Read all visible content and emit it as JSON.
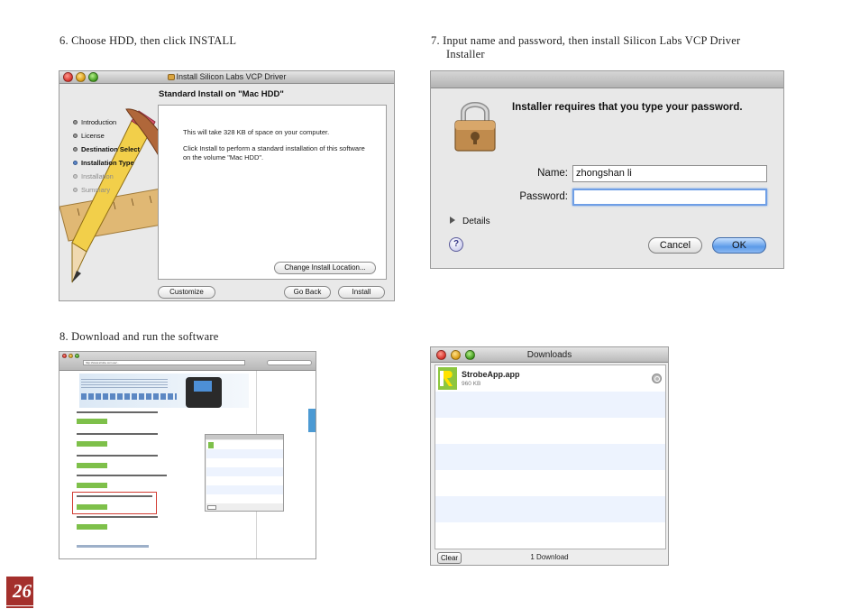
{
  "captions": {
    "step6": "6. Choose HDD, then click INSTALL",
    "step7_line1": "7. Input name and password, then install Silicon Labs VCP Driver",
    "step7_line2": "Installer",
    "step8": "8. Download and run the software"
  },
  "installer": {
    "title": "Install Silicon Labs VCP Driver",
    "heading": "Standard Install on \"Mac HDD\"",
    "steps": [
      {
        "label": "Introduction",
        "state": "done"
      },
      {
        "label": "License",
        "state": "done"
      },
      {
        "label": "Destination Select",
        "state": "done"
      },
      {
        "label": "Installation Type",
        "state": "active"
      },
      {
        "label": "Installation",
        "state": "pending"
      },
      {
        "label": "Summary",
        "state": "pending"
      }
    ],
    "space_text": "This will take 328 KB of space on your computer.",
    "install_text": "Click Install to perform a standard installation of this software on the volume \"Mac HDD\".",
    "change_location_label": "Change Install Location...",
    "customize_label": "Customize",
    "go_back_label": "Go Back",
    "install_label": "Install"
  },
  "auth": {
    "message": "Installer requires that you type your password.",
    "name_label": "Name:",
    "name_value": "zhongshan li",
    "password_label": "Password:",
    "password_value": "",
    "details_label": "Details",
    "help_label": "?",
    "cancel_label": "Cancel",
    "ok_label": "OK"
  },
  "browser": {
    "url": "http://www.strobe.com.au/..."
  },
  "downloads": {
    "title": "Downloads",
    "item_name": "StrobeApp.app",
    "item_size": "960 KB",
    "clear_label": "Clear",
    "count_label": "1 Download"
  },
  "page_number": "26"
}
